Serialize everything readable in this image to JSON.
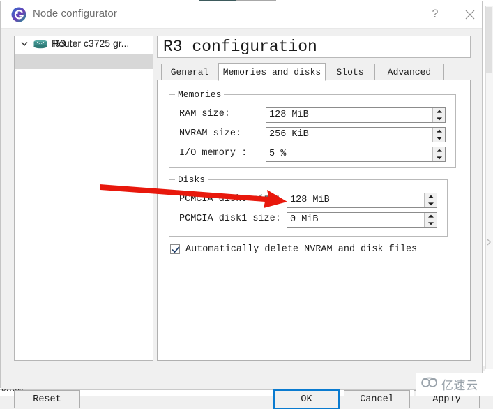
{
  "window": {
    "title": "Node configurator",
    "app_icon": "gns3-icon",
    "help_label": "?",
    "close_label": "×"
  },
  "tree": {
    "root": {
      "label": "Router c3725 gr...",
      "icon": "router-icon",
      "expanded": true
    },
    "child": {
      "label": "R3",
      "selected": true
    }
  },
  "page": {
    "title": "R3 configuration"
  },
  "tabs": [
    {
      "label": "General",
      "active": false
    },
    {
      "label": "Memories and disks",
      "active": true
    },
    {
      "label": "Slots",
      "active": false
    },
    {
      "label": "Advanced",
      "active": false
    }
  ],
  "memories": {
    "group_title": "Memories",
    "fields": [
      {
        "label": "RAM size:",
        "value": "128 MiB"
      },
      {
        "label": "NVRAM size:",
        "value": "256 KiB"
      },
      {
        "label": "I/O memory :",
        "value": "5 %"
      }
    ]
  },
  "disks": {
    "group_title": "Disks",
    "fields": [
      {
        "label": "PCMCIA disk0 size:",
        "value": "128 MiB"
      },
      {
        "label": "PCMCIA disk1 size:",
        "value": "0 MiB"
      }
    ]
  },
  "auto_delete": {
    "label": "Automatically delete NVRAM and disk files",
    "checked": true
  },
  "buttons": {
    "reset": "Reset",
    "ok": "OK",
    "cancel": "Cancel",
    "apply": "Apply"
  },
  "annotation": {
    "type": "red-arrow",
    "color": "#e8180c",
    "points_to": "PCMCIA disk0 size"
  },
  "watermark": {
    "text": "亿速云",
    "logo": "cloud-logo"
  },
  "background": {
    "bottom_text": "b…ö。",
    "accent_color": "#3d5a5c"
  },
  "colors": {
    "focus_blue": "#0a7bd0",
    "selection_gray": "#d7d7d7",
    "dialog_bg": "#f0f0f0",
    "router_teal": "#3d8d8a"
  }
}
